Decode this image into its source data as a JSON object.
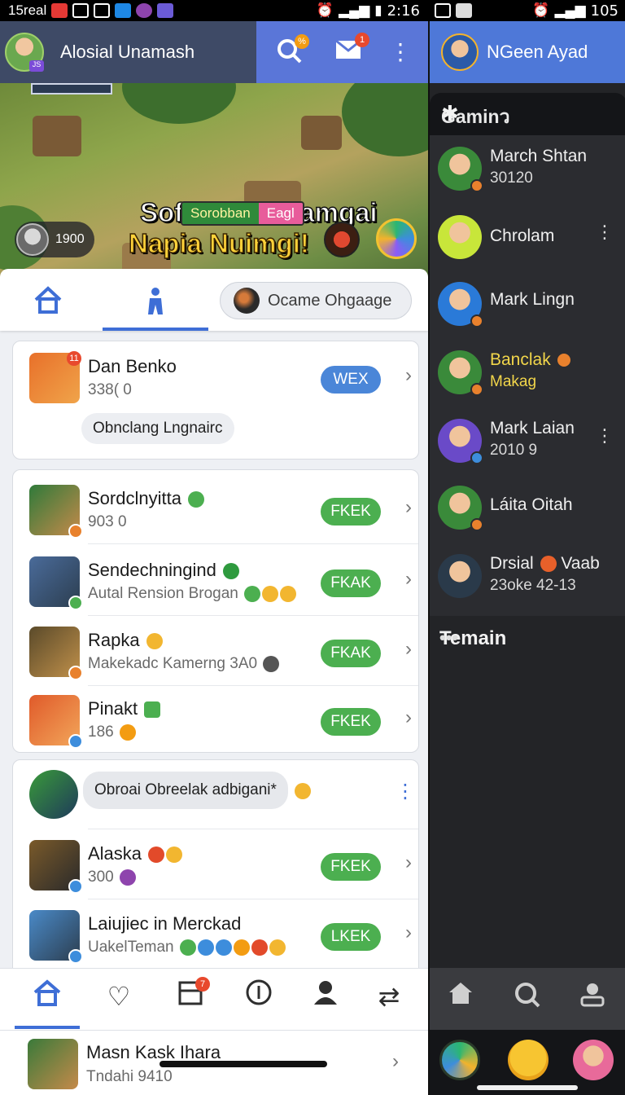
{
  "status_left": {
    "carrier": "15real",
    "time": "2:16"
  },
  "status_right": {
    "battery": "105"
  },
  "header": {
    "username": "Alosial Unamash",
    "search_badge": "%",
    "mail_badge": "1",
    "level": "JS"
  },
  "banner": {
    "title_line1": "Sofile ik Rlalamgai",
    "title_line2": "Napia Nuimgi!",
    "pill_left": "Sorobban",
    "pill_right": "Eagl",
    "score": "1900"
  },
  "tabs": {
    "search_label": "Ocame Ohgaage"
  },
  "card1": {
    "name": "Dan Benko",
    "sub": "338( 0",
    "button": "WEX",
    "chip": "Obnclang Lngnairc",
    "badge": "11"
  },
  "card2": {
    "rows": [
      {
        "name": "Sordclnyitta",
        "sub": "903 0",
        "button": "FKEK"
      },
      {
        "name": "Sendechningind",
        "sub": "Autal Rension Brogan",
        "button": "FKAK"
      },
      {
        "name": "Rapka",
        "sub": "Makekadc Kamerng 3A0",
        "button": "FKAK"
      },
      {
        "name": "Pinakt",
        "sub": "186",
        "button": "FKEK"
      }
    ]
  },
  "card3": {
    "chip": "Obroai Obreelak adbigani*",
    "rows": [
      {
        "name": "Alaska",
        "sub": "300",
        "button": "FKEK"
      },
      {
        "name": "Laiujiec in Merckad",
        "sub": "UakelTeman",
        "button": "LKEK"
      }
    ]
  },
  "bottomnav": {
    "badge": "7"
  },
  "bottom_row": {
    "name": "Masn Kask Ihara",
    "sub": "Tndahi 9410"
  },
  "right_panel": {
    "username": "NGeen Ayad",
    "section_title": "Gaminว",
    "friends": [
      {
        "line1": "March Shtan",
        "line2": "30120"
      },
      {
        "line1": "Chrolam",
        "line2": ""
      },
      {
        "line1": "Mark Lingn",
        "line2": ""
      },
      {
        "line1": "Banclak",
        "line2": "Makag"
      },
      {
        "line1": "Mark Laian",
        "line2": "2010 9"
      },
      {
        "line1": "Láita Oitah",
        "line2": ""
      },
      {
        "line1": "Drsial",
        "line1b": "Vaab",
        "line2": "23oke 42-13"
      }
    ],
    "section2_title": "Temain"
  }
}
